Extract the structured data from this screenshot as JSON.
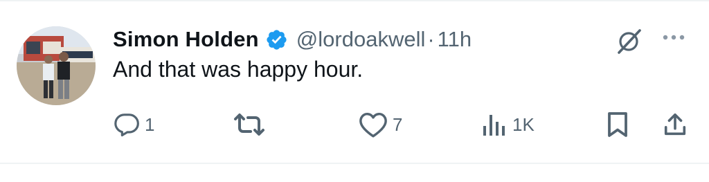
{
  "tweet": {
    "author": {
      "display_name": "Simon Holden",
      "handle": "@lordoakwell",
      "separator": "·",
      "time": "11h",
      "verified": true,
      "verified_color": "#1d9bf0"
    },
    "text": "And that was happy hour.",
    "actions": {
      "replies": {
        "icon": "reply-icon",
        "count": "1"
      },
      "retweets": {
        "icon": "retweet-icon",
        "count": ""
      },
      "likes": {
        "icon": "heart-icon",
        "count": "7"
      },
      "views": {
        "icon": "views-icon",
        "count": "1K"
      },
      "bookmark": {
        "icon": "bookmark-icon"
      },
      "share": {
        "icon": "share-icon"
      }
    },
    "header_icons": [
      "grok-icon",
      "more-icon"
    ]
  },
  "colors": {
    "text_primary": "#0f1419",
    "text_secondary": "#536471",
    "divider": "#eff3f4"
  }
}
